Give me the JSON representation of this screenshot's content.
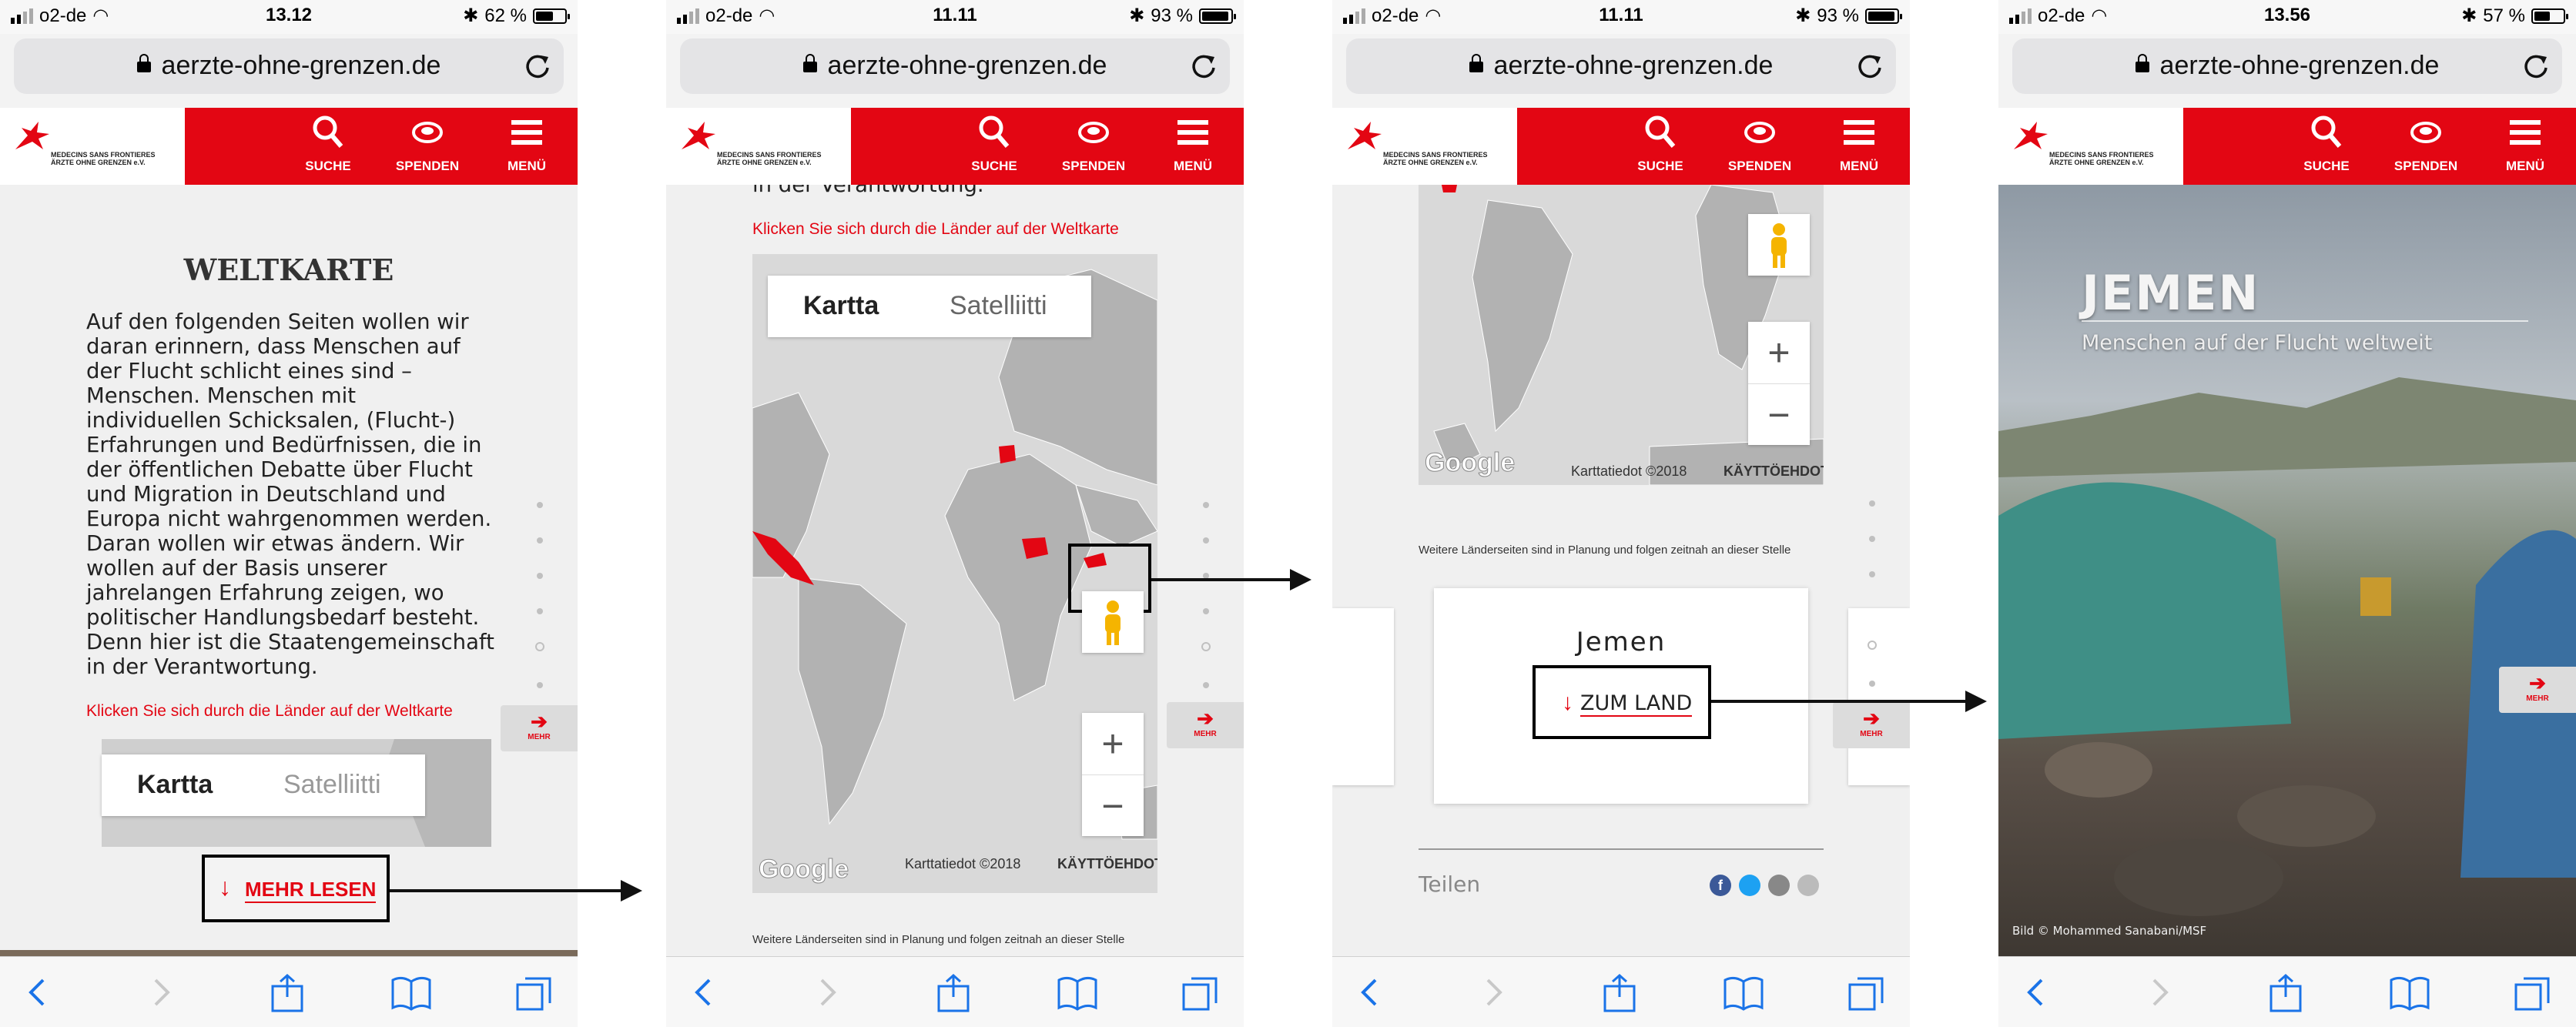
{
  "status": [
    {
      "carrier": "o2-de",
      "time": "13.12",
      "battery": "62 %",
      "battery_level": 0.62
    },
    {
      "carrier": "o2-de",
      "time": "11.11",
      "battery": "93 %",
      "battery_level": 0.93
    },
    {
      "carrier": "o2-de",
      "time": "11.11",
      "battery": "93 %",
      "battery_level": 0.93
    },
    {
      "carrier": "o2-de",
      "time": "13.56",
      "battery": "57 %",
      "battery_level": 0.57
    }
  ],
  "url": "aerzte-ohne-grenzen.de",
  "logo": {
    "line1": "MEDECINS SANS FRONTIERES",
    "line2": "ÄRZTE OHNE GRENZEN e.V."
  },
  "nav": {
    "search": "SUCHE",
    "donate": "SPENDEN",
    "menu": "MENÜ"
  },
  "screen1": {
    "heading": "WELTKARTE",
    "paragraph": [
      "Auf den folgenden Seiten wollen wir",
      "daran erinnern, dass Menschen auf",
      "der Flucht schlicht eines sind –",
      "Menschen. Menschen mit",
      "individuellen Schicksalen, (Flucht-)",
      "Erfahrungen und Bedürfnissen, die in",
      "der öffentlichen Debatte über Flucht",
      "und Migration in Deutschland und",
      "Europa nicht wahrgenommen werden.",
      "Daran wollen wir etwas ändern. Wir",
      "wollen auf der Basis unserer",
      "jahrelangen Erfahrung zeigen, wo",
      "politischer Handlungsbedarf besteht.",
      "Denn hier ist die Staatengemeinschaft",
      "in der Verantwortung."
    ],
    "link": "Klicken Sie sich durch die Länder auf der Weltkarte",
    "map_type": [
      "Kartta",
      "Satelliitti"
    ],
    "read_more": "MEHR LESEN",
    "more": "MEHR"
  },
  "screen2": {
    "top_text": "in der Verantwortung.",
    "link": "Klicken Sie sich durch die Länder auf der Weltkarte",
    "map_type": [
      "Kartta",
      "Satelliitti"
    ],
    "map_data": "Karttatiedot ©2018",
    "terms": "KÄYTTÖEHDOT",
    "google": "Google",
    "more": "MEHR",
    "footer": "Weitere Länderseiten sind in Planung und folgen zeitnah an dieser Stelle"
  },
  "screen3": {
    "map_data": "Karttatiedot ©2018",
    "terms": "KÄYTTÖEHDOT",
    "google": "Google",
    "planning": "Weitere Länderseiten sind in Planung und folgen zeitnah an dieser Stelle",
    "country": "Jemen",
    "to_country": "ZUM LAND",
    "share": "Teilen",
    "more": "MEHR"
  },
  "screen4": {
    "title": "JEMEN",
    "subtitle": "Menschen auf der Flucht weltweit",
    "credit": "Bild © Mohammed Sanabani/MSF",
    "more": "MEHR"
  },
  "colors": {
    "msf_red": "#e30613",
    "ios_blue": "#1a73e8"
  }
}
